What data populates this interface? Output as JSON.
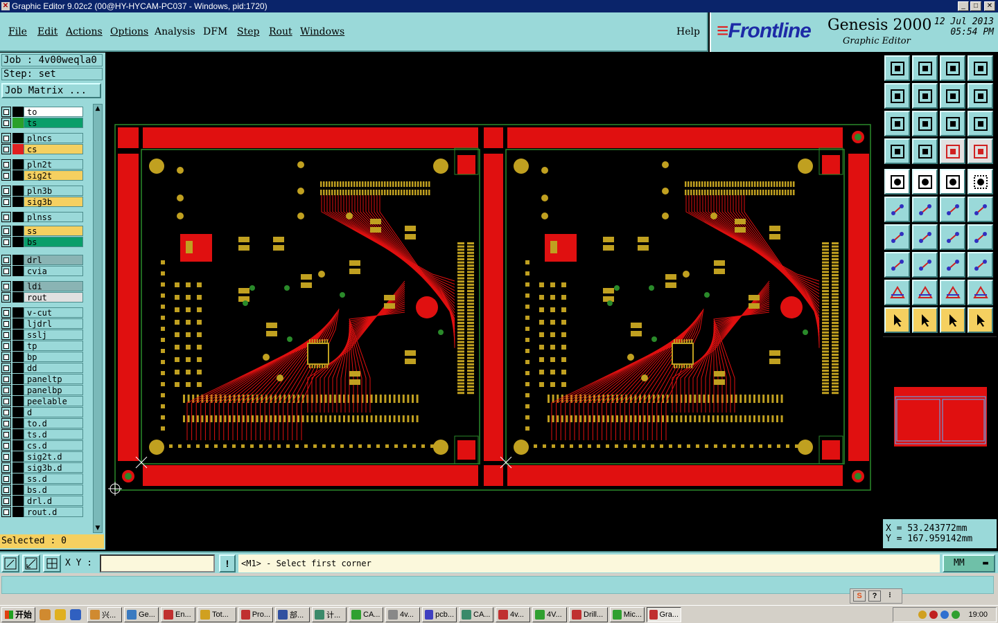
{
  "window": {
    "title": "Graphic Editor 9.02c2 (00@HY-HYCAM-PC037 - Windows, pid:1720)"
  },
  "menu": [
    {
      "label": "File"
    },
    {
      "label": "Edit"
    },
    {
      "label": "Actions"
    },
    {
      "label": "Options"
    },
    {
      "label": "Analysis"
    },
    {
      "label": "DFM"
    },
    {
      "label": "Step"
    },
    {
      "label": "Rout"
    },
    {
      "label": "Windows"
    },
    {
      "label": "Help"
    }
  ],
  "brand": {
    "logo": "Frontline",
    "product": "Genesis 2000",
    "subtitle": "Graphic Editor",
    "date": "12 Jul 2013",
    "time": "05:54 PM"
  },
  "job": {
    "label": "Job : 4v00weqla0",
    "step": "Step: set",
    "matrix_button": "Job Matrix ..."
  },
  "layers": [
    {
      "name": "to",
      "bg": "#ffffff",
      "swatch": "#000000"
    },
    {
      "name": "ts",
      "bg": "#0a9e6a",
      "swatch": "#2aa02a"
    },
    {
      "name": "plncs",
      "bg": "#9ad9d9",
      "swatch": "#000000"
    },
    {
      "name": "cs",
      "bg": "#f5d060",
      "swatch": "#e02020",
      "mark": "▪"
    },
    {
      "name": "pln2t",
      "bg": "#9ad9d9",
      "swatch": "#000000"
    },
    {
      "name": "sig2t",
      "bg": "#f5d060",
      "swatch": "#000000"
    },
    {
      "name": "pln3b",
      "bg": "#9ad9d9",
      "swatch": "#000000"
    },
    {
      "name": "sig3b",
      "bg": "#f5d060",
      "swatch": "#000000"
    },
    {
      "name": "plnss",
      "bg": "#9ad9d9",
      "swatch": "#000000"
    },
    {
      "name": "ss",
      "bg": "#f5d060",
      "swatch": "#000000"
    },
    {
      "name": "bs",
      "bg": "#0a9e6a",
      "swatch": "#000000"
    },
    {
      "name": "drl",
      "bg": "#8ab4b4",
      "swatch": "#000000"
    },
    {
      "name": "cvia",
      "bg": "#9ad9d9",
      "swatch": "#000000"
    },
    {
      "name": "ldi",
      "bg": "#8ab4b4",
      "swatch": "#000000"
    },
    {
      "name": "rout",
      "bg": "#e0e0e0",
      "swatch": "#000000"
    },
    {
      "name": "v-cut",
      "bg": "#9ad9d9",
      "swatch": "#000000"
    },
    {
      "name": "ljdrl",
      "bg": "#9ad9d9",
      "swatch": "#000000"
    },
    {
      "name": "sslj",
      "bg": "#9ad9d9",
      "swatch": "#000000"
    },
    {
      "name": "tp",
      "bg": "#9ad9d9",
      "swatch": "#000000"
    },
    {
      "name": "bp",
      "bg": "#9ad9d9",
      "swatch": "#000000"
    },
    {
      "name": "dd",
      "bg": "#9ad9d9",
      "swatch": "#000000"
    },
    {
      "name": "paneltp",
      "bg": "#9ad9d9",
      "swatch": "#000000"
    },
    {
      "name": "panelbp",
      "bg": "#9ad9d9",
      "swatch": "#000000"
    },
    {
      "name": "peelable",
      "bg": "#9ad9d9",
      "swatch": "#000000"
    },
    {
      "name": "d",
      "bg": "#9ad9d9",
      "swatch": "#000000"
    },
    {
      "name": "to.d",
      "bg": "#9ad9d9",
      "swatch": "#000000",
      "mark": "↗"
    },
    {
      "name": "ts.d",
      "bg": "#9ad9d9",
      "swatch": "#000000",
      "mark": "↗"
    },
    {
      "name": "cs.d",
      "bg": "#9ad9d9",
      "swatch": "#000000",
      "mark": "↗"
    },
    {
      "name": "sig2t.d",
      "bg": "#9ad9d9",
      "swatch": "#000000",
      "mark": "↗"
    },
    {
      "name": "sig3b.d",
      "bg": "#9ad9d9",
      "swatch": "#000000",
      "mark": "↗"
    },
    {
      "name": "ss.d",
      "bg": "#9ad9d9",
      "swatch": "#000000",
      "mark": "↗"
    },
    {
      "name": "bs.d",
      "bg": "#9ad9d9",
      "swatch": "#000000",
      "mark": "↗"
    },
    {
      "name": "drl.d",
      "bg": "#9ad9d9",
      "swatch": "#000000"
    },
    {
      "name": "rout.d",
      "bg": "#9ad9d9",
      "swatch": "#000000"
    }
  ],
  "selected": "Selected : 0",
  "coords": {
    "x": "X  =  53.243772mm",
    "y": "Y  = 167.959142mm"
  },
  "command": {
    "xy_label": "X Y :",
    "xy_value": "",
    "message": "<M1> - Select first corner",
    "unit": "MM"
  },
  "taskbar": {
    "start": "开始",
    "tasks": [
      "兴...",
      "Ge...",
      "En...",
      "Tot...",
      "Pro...",
      "部...",
      "计...",
      "CA...",
      "4v...",
      "pcb...",
      "CA...",
      "4v...",
      "4V...",
      "Drill...",
      "Mic...",
      "Gra..."
    ],
    "clock": "19:00"
  },
  "colors": {
    "panel": "#9ad9d9",
    "copper": "#e01010",
    "pad": "#c0a020",
    "outline": "#2a8a2a",
    "highlight": "#f5d060"
  }
}
